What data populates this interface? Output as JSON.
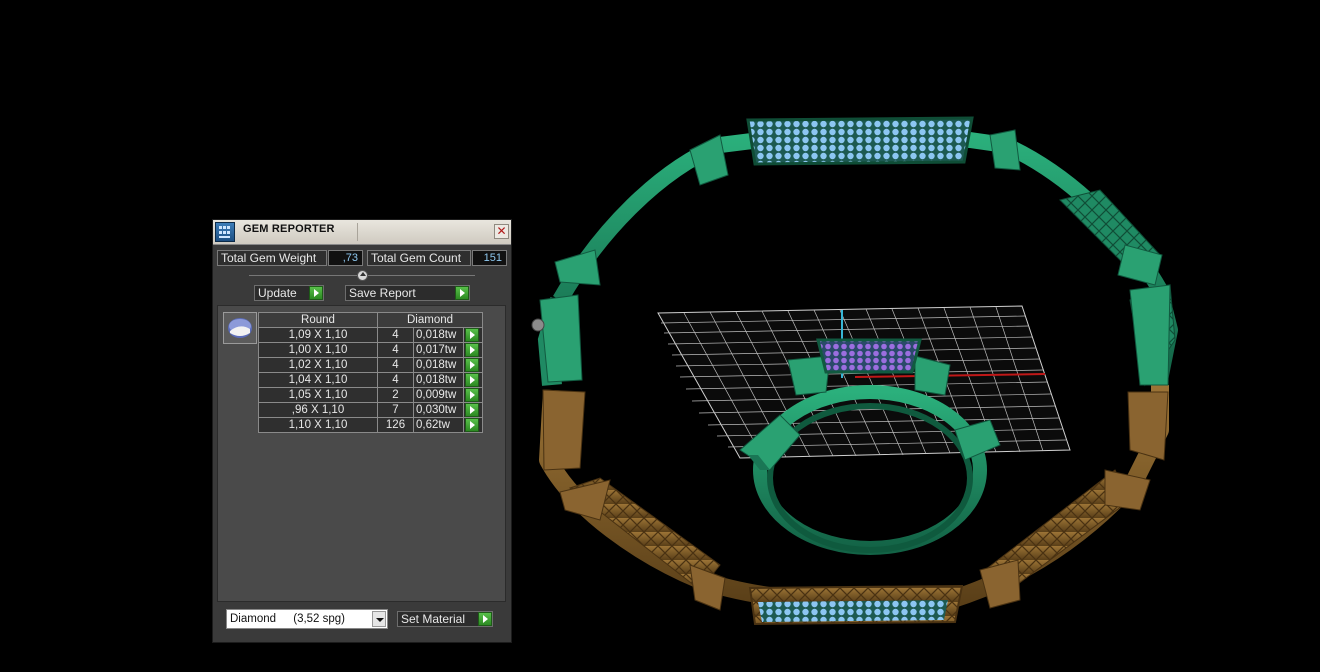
{
  "panel": {
    "title": "GEM REPORTER",
    "total_weight_label": "Total Gem Weight",
    "total_weight_value": ",73",
    "total_count_label": "Total Gem Count",
    "total_count_value": "151",
    "update_label": "Update",
    "save_report_label": "Save Report",
    "table": {
      "header_shape": "Round",
      "header_material": "Diamond",
      "rows": [
        {
          "size": "1,09 X 1,10",
          "count": "4",
          "weight": "0,018tw"
        },
        {
          "size": "1,00 X 1,10",
          "count": "4",
          "weight": "0,017tw"
        },
        {
          "size": "1,02 X 1,10",
          "count": "4",
          "weight": "0,018tw"
        },
        {
          "size": "1,04 X 1,10",
          "count": "4",
          "weight": "0,018tw"
        },
        {
          "size": "1,05 X 1,10",
          "count": "2",
          "weight": "0,009tw"
        },
        {
          "size": ",96 X 1,10",
          "count": "7",
          "weight": "0,030tw"
        },
        {
          "size": "1,10 X 1,10",
          "count": "126",
          "weight": "0,62tw"
        }
      ]
    },
    "material_select": {
      "value": "Diamond",
      "spg": "(3,52 spg)"
    },
    "set_material_label": "Set Material",
    "icons": {
      "close": "close-icon",
      "go": "green-arrow-icon",
      "gem": "round-gem-icon",
      "window": "gem-reporter-icon",
      "dropdown": "chevron-down-icon"
    }
  },
  "colors": {
    "viewport_bg": "#000000",
    "ring_green": "#1f8a63",
    "ring_bronze": "#7a5a2a",
    "gems_blue": "#8cc6f2",
    "gems_purple": "#9b6ee0",
    "grid": "#cfcfcf",
    "axis_red": "#c01818",
    "axis_cyan": "#37b6d6",
    "panel_bg": "#3a3a3a",
    "go_green": "#3fa833"
  }
}
